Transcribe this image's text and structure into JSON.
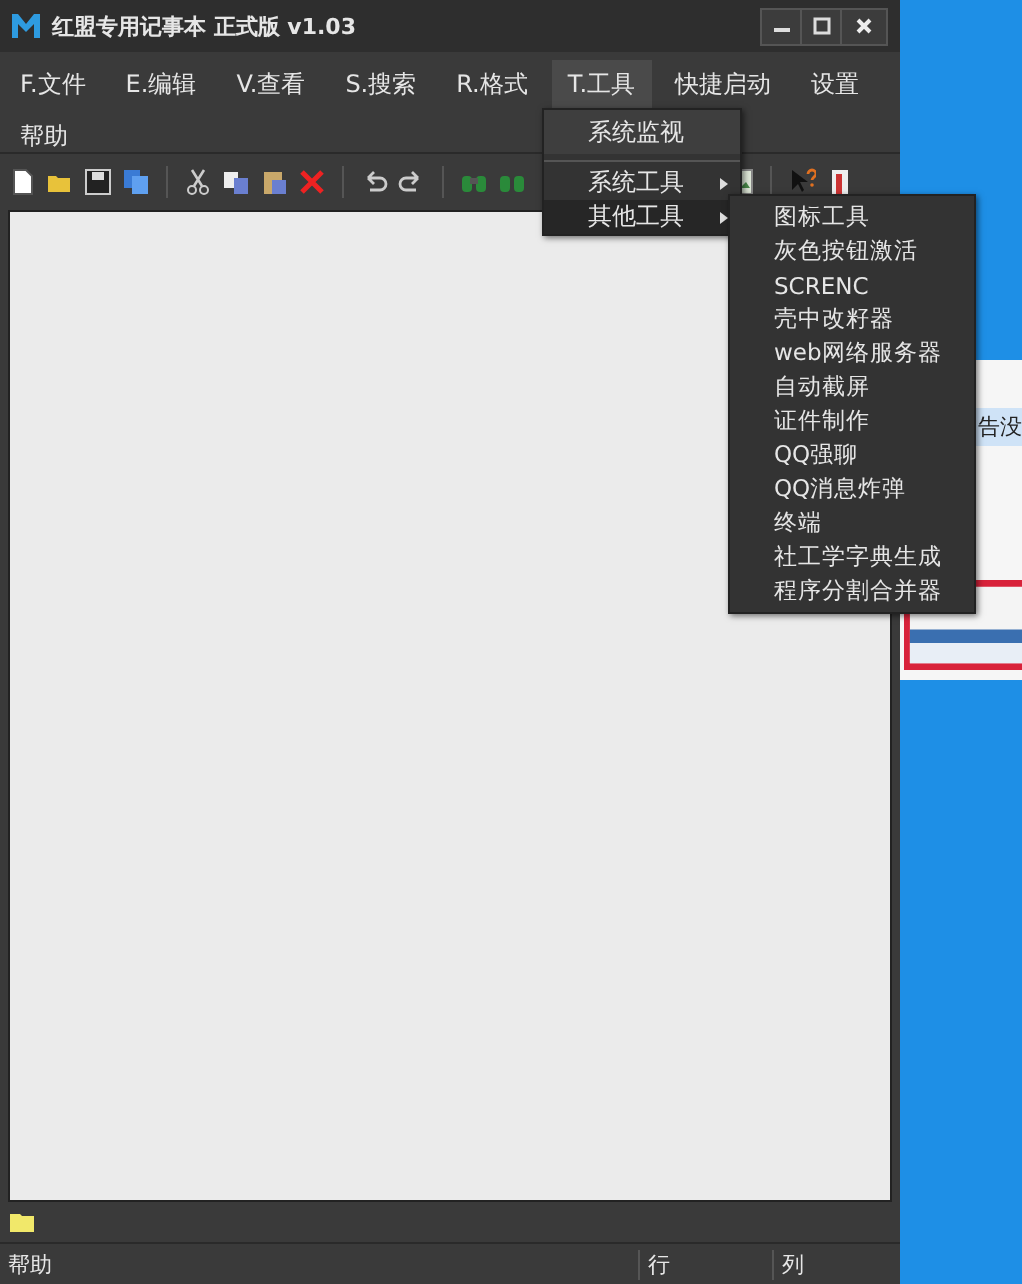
{
  "window": {
    "title": "红盟专用记事本 正式版 v1.03"
  },
  "menu_bar": [
    {
      "label": "F.文件",
      "selected": false
    },
    {
      "label": "E.编辑",
      "selected": false
    },
    {
      "label": "V.查看",
      "selected": false
    },
    {
      "label": "S.搜索",
      "selected": false
    },
    {
      "label": "R.格式",
      "selected": false
    },
    {
      "label": "T.工具",
      "selected": true
    },
    {
      "label": "快捷启动",
      "selected": false
    },
    {
      "label": "设置",
      "selected": false
    },
    {
      "label": "帮助",
      "selected": false
    }
  ],
  "tools_menu": [
    {
      "label": "系统监视",
      "kind": "item",
      "selected": false
    },
    {
      "label": "系统工具",
      "kind": "submenu",
      "selected": false
    },
    {
      "label": "其他工具",
      "kind": "submenu",
      "selected": true
    }
  ],
  "submenu": [
    "图标工具",
    "灰色按钮激活",
    "SCRENC",
    "壳中改籽器",
    "web网络服务器",
    "自动截屏",
    "证件制作",
    "QQ强聊",
    "QQ消息炸弹",
    "终端",
    "社工学字典生成",
    "程序分割合并器"
  ],
  "status_bar": {
    "help": "帮助",
    "line": "行",
    "column": "列"
  },
  "background_window": {
    "text": "告没"
  }
}
